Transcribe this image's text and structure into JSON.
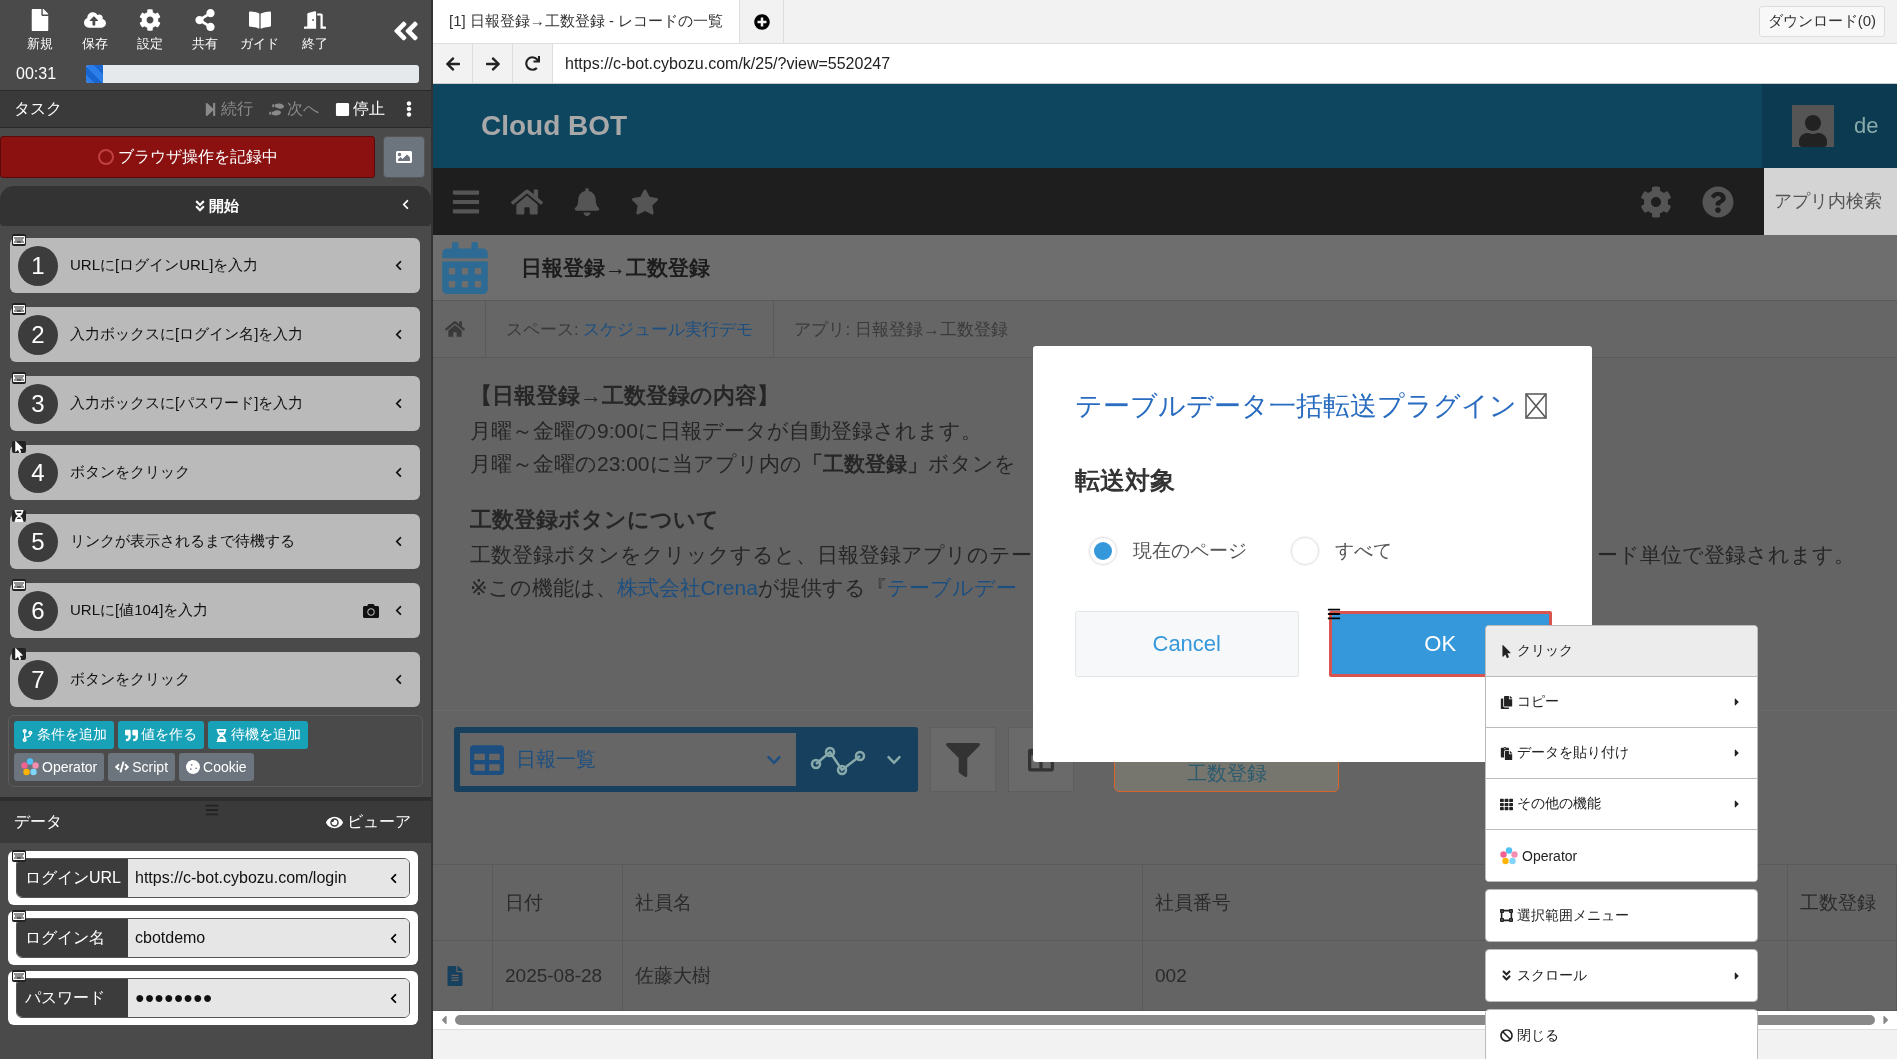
{
  "sidebar": {
    "toolbar": [
      {
        "label": "新規"
      },
      {
        "label": "保存"
      },
      {
        "label": "設定"
      },
      {
        "label": "共有"
      },
      {
        "label": "ガイド"
      },
      {
        "label": "終了"
      }
    ],
    "timer": "00:31",
    "progress": {
      "level": 0.05
    },
    "task_header": {
      "title": "タスク",
      "actions": [
        {
          "label": "続行",
          "disabled": true
        },
        {
          "label": "次へ",
          "disabled": true
        },
        {
          "label": "停止",
          "disabled": false
        }
      ]
    },
    "record_button": "ブラウザ操作を記録中",
    "section": {
      "label": "開始",
      "expanded": true
    },
    "steps": [
      {
        "number": "1",
        "text": "URLに[ログインURL]を入力",
        "kind": "input",
        "screenshot": false
      },
      {
        "number": "2",
        "text": "入力ボックスに[ログイン名]を入力",
        "kind": "input",
        "screenshot": false
      },
      {
        "number": "3",
        "text": "入力ボックスに[パスワード]を入力",
        "kind": "input",
        "screenshot": false
      },
      {
        "number": "4",
        "text": "ボタンをクリック",
        "kind": "click",
        "screenshot": false
      },
      {
        "number": "5",
        "text": "リンクが表示されるまで待機する",
        "kind": "wait",
        "screenshot": false
      },
      {
        "number": "6",
        "text": "URLに[値104]を入力",
        "kind": "input",
        "screenshot": true
      },
      {
        "number": "7",
        "text": "ボタンをクリック",
        "kind": "click",
        "screenshot": false
      }
    ],
    "add_buttons": [
      {
        "label": "条件を追加"
      },
      {
        "label": "値を作る"
      },
      {
        "label": "待機を追加"
      }
    ],
    "tool_buttons": [
      {
        "label": "Operator"
      },
      {
        "label": "Script"
      },
      {
        "label": "Cookie"
      }
    ],
    "data_header": {
      "title": "データ",
      "viewer": "ビューア"
    },
    "data_rows": [
      {
        "name": "ログインURL",
        "value": "https://c-bot.cybozu.com/login"
      },
      {
        "name": "ログイン名",
        "value": "cbotdemo"
      },
      {
        "name": "パスワード",
        "value": "●●●●●●●●"
      }
    ]
  },
  "browser": {
    "tabs": [
      {
        "label": "[1] 日報登録→工数登録 - レコードの一覧",
        "selected": true
      }
    ],
    "download": "ダウンロード(0)",
    "url": "https://c-bot.cybozu.com/k/25/?view=5520247"
  },
  "page": {
    "logo": "Cloud BOT",
    "user": "de",
    "search_placeholder": "アプリ内検索",
    "app_title": "日報登録→工数登録",
    "breadcrumb": [
      {
        "prefix": "スペース: ",
        "link": "スケジュール実行デモ"
      },
      {
        "prefix": "アプリ: 日報登録→工数登録"
      }
    ],
    "description": {
      "heading": "【日報登録→工数登録の内容】",
      "lines": [
        "月曜～金曜の9:00に日報データが自動登録されます。",
        "月曜～金曜の23:00に当アプリ内の**「工数登録」**ボタンを"
      ],
      "subheading": "工数登録ボタンについて",
      "line3_left": "工数登録ボタンをクリックすると、日報登録アプリのテー",
      "line3_right": "ード単位で登録されます。",
      "line4": {
        "before": "※この機能は、",
        "link": "株式会社Crena",
        "middle": "が提供する『",
        "link2": "テーブルデー"
      }
    },
    "view_select": "日報一覧",
    "action_button": "工数登録",
    "table": {
      "columns": [
        "日付",
        "社員名",
        "社員番号",
        "工数登録"
      ],
      "rows": [
        [
          "2025-08-28",
          "佐藤大樹",
          "002"
        ]
      ]
    }
  },
  "dialog": {
    "title": "テーブルデータ一括転送プラグイン",
    "section": "転送対象",
    "options": [
      {
        "label": "現在のページ",
        "selected": true
      },
      {
        "label": "すべて",
        "selected": false
      }
    ],
    "buttons": [
      {
        "label": "Cancel",
        "kind": "secondary",
        "targeted": false
      },
      {
        "label": "OK",
        "kind": "primary",
        "targeted": true
      }
    ]
  },
  "context_menu": {
    "groups": [
      [
        {
          "label": "クリック",
          "has_submenu": false,
          "highlighted": true
        },
        {
          "label": "コピー",
          "has_submenu": true,
          "highlighted": false
        },
        {
          "label": "データを貼り付け",
          "has_submenu": true,
          "highlighted": false
        },
        {
          "label": "その他の機能",
          "has_submenu": true,
          "highlighted": false
        },
        {
          "label": "Operator",
          "has_submenu": false,
          "highlighted": false
        }
      ],
      [
        {
          "label": "選択範囲メニュー",
          "has_submenu": false,
          "highlighted": false
        }
      ],
      [
        {
          "label": "スクロール",
          "has_submenu": true,
          "highlighted": false
        }
      ],
      [
        {
          "label": "閉じる",
          "has_submenu": false,
          "highlighted": false
        }
      ]
    ]
  }
}
